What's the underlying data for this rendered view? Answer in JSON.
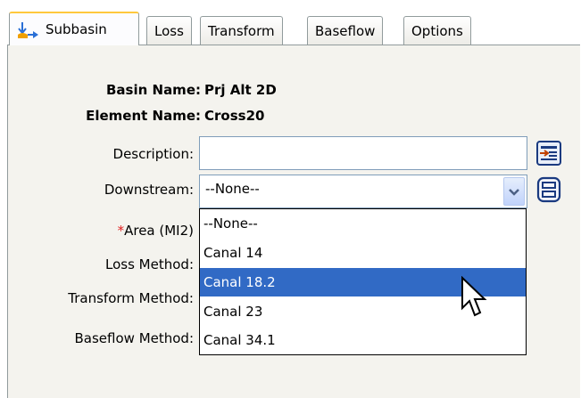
{
  "tabs": [
    {
      "label": "Subbasin",
      "icon": "subbasin-icon",
      "active": true
    },
    {
      "label": "Loss"
    },
    {
      "label": "Transform"
    },
    {
      "label": "Baseflow"
    },
    {
      "label": "Options"
    }
  ],
  "form": {
    "basin_name_label": "Basin Name:",
    "basin_name_value": "Prj Alt 2D",
    "element_name_label": "Element Name:",
    "element_name_value": "Cross20",
    "description_label": "Description:",
    "description_value": "",
    "downstream_label": "Downstream:",
    "downstream_value": "--None--",
    "area_required": "*",
    "area_label": "Area (MI2)",
    "loss_method_label": "Loss Method:",
    "transform_method_label": "Transform Method:",
    "baseflow_method_label": "Baseflow Method:"
  },
  "dropdown": {
    "options": [
      "--None--",
      "Canal 14",
      "Canal 18.2",
      "Canal 23",
      "Canal 34.1"
    ],
    "selected_index": 2
  },
  "colors": {
    "selection": "#316ac5",
    "panel": "#f4f3ee",
    "active_tab_accent": "#ffc83c",
    "required_marker": "#e02020"
  }
}
